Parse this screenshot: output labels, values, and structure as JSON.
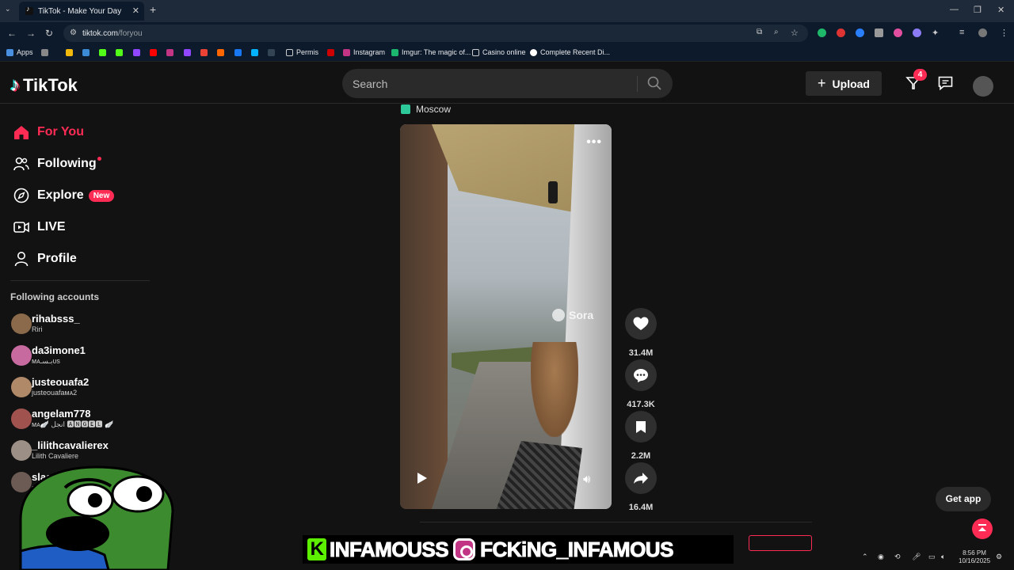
{
  "browser": {
    "tab_title": "TikTok - Make Your Day",
    "url_host": "tiktok.com",
    "url_path": "/foryou",
    "bookmarks": [
      "Apps",
      "Permis",
      "Instagram",
      "Imgur: The magic of...",
      "Casino online",
      "Complete Recent Di..."
    ]
  },
  "header": {
    "logo": "TikTok",
    "search_placeholder": "Search",
    "upload_label": "Upload",
    "inbox_badge": "4"
  },
  "sidebar": {
    "nav": [
      {
        "label": "For You",
        "active": true
      },
      {
        "label": "Following"
      },
      {
        "label": "Explore",
        "badge": "New"
      },
      {
        "label": "LIVE"
      },
      {
        "label": "Profile"
      }
    ],
    "following_title": "Following accounts",
    "accounts": [
      {
        "username": "rihabsss_",
        "display": "Riri"
      },
      {
        "username": "da3imone1",
        "display": "ᴍᴀبـسـᴜs"
      },
      {
        "username": "justeouafa2",
        "display": "justeouafaᴍᴀ2"
      },
      {
        "username": "angelam778",
        "display": "ᴍᴀ🪽 انجل 🅰🅽🅶🅴🅻 🪽"
      },
      {
        "username": "_lilithcavalierex",
        "display": "Lilith Cavaliere"
      },
      {
        "username": "slaa",
        "display": "sla"
      }
    ]
  },
  "video": {
    "location": "Moscow",
    "watermark": "Sora",
    "likes": "31.4M",
    "comments": "417.3K",
    "saves": "2.2M",
    "shares": "16.4M"
  },
  "get_app": "Get app",
  "overlay": {
    "text1": "INFAMOUSS",
    "text2": "FCKiNG_INFAMOUS",
    "k_logo": "K"
  },
  "taskbar": {
    "time": "8:56 PM",
    "date": "10/16/2025"
  }
}
